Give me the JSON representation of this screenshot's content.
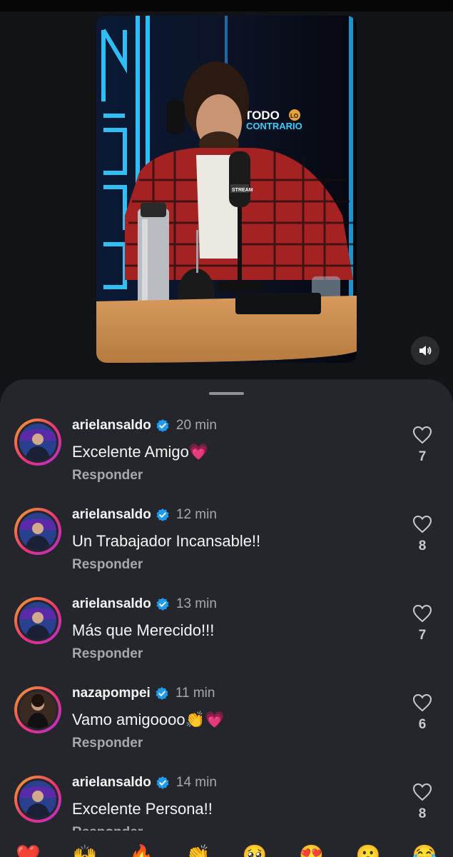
{
  "post": {
    "image_alt": "",
    "sign_text": "TODO",
    "sign_text_small": "LO",
    "sign_text2": "CONTRARIO",
    "mic_label": "STREAM",
    "sound_icon": "speaker-icon"
  },
  "comments": [
    {
      "username": "arielansaldo",
      "verified": true,
      "time": "20 min",
      "text": "Excelente Amigo",
      "emoji": "💗",
      "reply": "Responder",
      "likes": "7"
    },
    {
      "username": "arielansaldo",
      "verified": true,
      "time": "12 min",
      "text": "Un Trabajador Incansable!!",
      "emoji": "",
      "reply": "Responder",
      "likes": "8"
    },
    {
      "username": "arielansaldo",
      "verified": true,
      "time": "13 min",
      "text": "Más que Merecido!!!",
      "emoji": "",
      "reply": "Responder",
      "likes": "7"
    },
    {
      "username": "nazapompei",
      "verified": true,
      "time": "11 min",
      "text": "Vamo amigoooo",
      "emoji": "👏💗",
      "reply": "Responder",
      "likes": "6"
    },
    {
      "username": "arielansaldo",
      "verified": true,
      "time": "14 min",
      "text": "Excelente Persona!!",
      "emoji": "",
      "reply": "Responder",
      "likes": "8"
    }
  ],
  "reactions": [
    "❤️",
    "🙌",
    "🔥",
    "👏",
    "🥺",
    "😍",
    "😮",
    "😂"
  ],
  "colors": {
    "background": "#121316",
    "sheet": "#24262b",
    "verified": "#1d9bf0",
    "muted": "#a6a8ad"
  }
}
